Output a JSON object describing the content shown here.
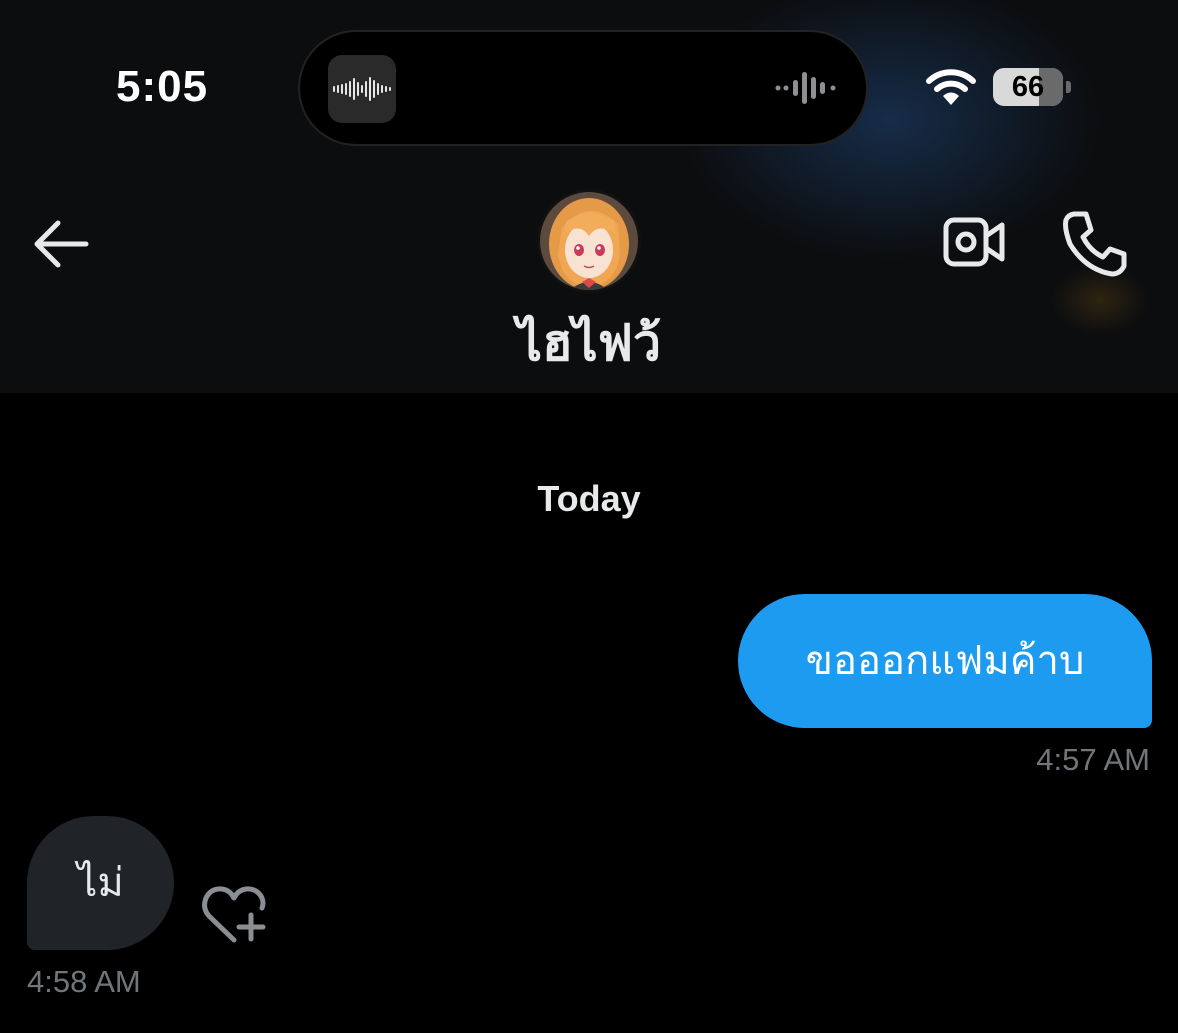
{
  "status_bar": {
    "time": "5:05",
    "battery_level": "66",
    "wifi_icon": "wifi-icon"
  },
  "header": {
    "contact_name": "ไฮไฟว้",
    "back_icon": "arrow-left-icon",
    "video_icon": "video-camera-icon",
    "call_icon": "phone-icon"
  },
  "conversation": {
    "date_label": "Today",
    "messages": [
      {
        "direction": "sent",
        "text": "ขอออกแฟมค้าบ",
        "time": "4:57 AM"
      },
      {
        "direction": "received",
        "text": "ไม่",
        "time": "4:58 AM"
      }
    ]
  },
  "colors": {
    "accent": "#1d9bf0",
    "received_bubble": "#202327",
    "muted_text": "#71767b",
    "background": "#000000"
  }
}
